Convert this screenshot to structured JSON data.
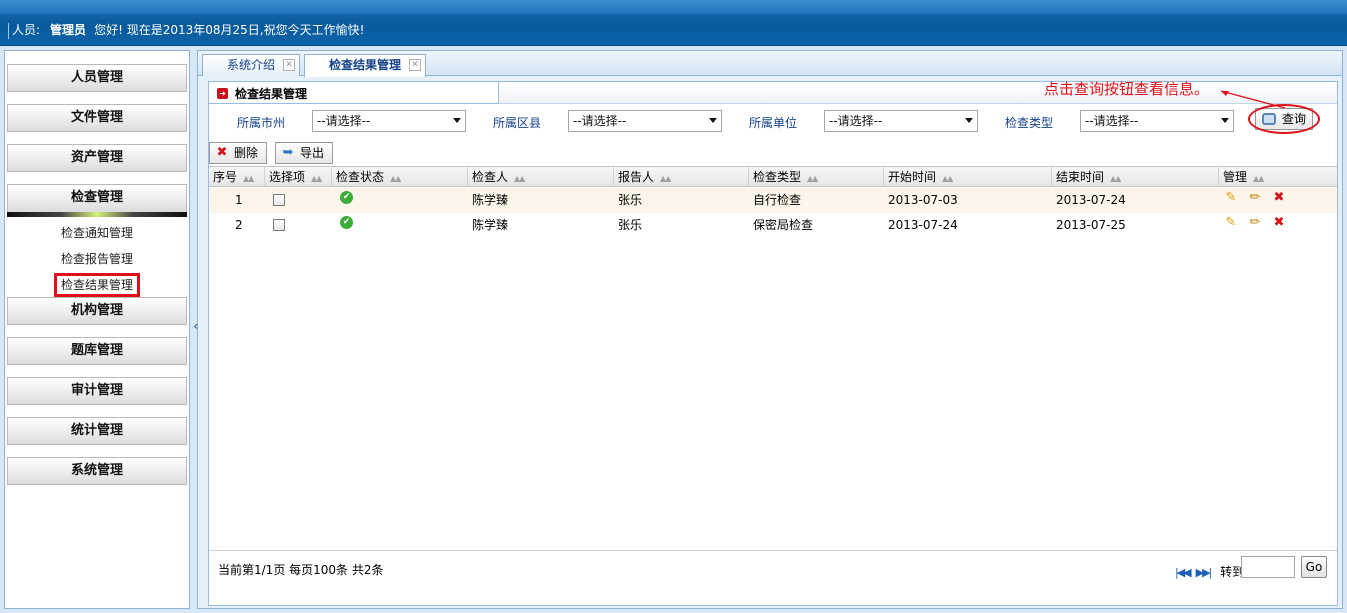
{
  "header": {
    "user_label": "人员:",
    "user_name": "管理员",
    "greeting": "您好!  现在是2013年08月25日,祝您今天工作愉快!"
  },
  "sidebar": {
    "menus": [
      {
        "label": "人员管理"
      },
      {
        "label": "文件管理"
      },
      {
        "label": "资产管理"
      },
      {
        "label": "检查管理"
      },
      {
        "label": "机构管理"
      },
      {
        "label": "题库管理"
      },
      {
        "label": "审计管理"
      },
      {
        "label": "统计管理"
      },
      {
        "label": "系统管理"
      }
    ],
    "submenu": [
      {
        "label": "检查通知管理"
      },
      {
        "label": "检查报告管理"
      },
      {
        "label": "检查结果管理"
      }
    ],
    "collapse_glyph": "«"
  },
  "tabs": [
    {
      "label": "系统介绍"
    },
    {
      "label": "检查结果管理"
    }
  ],
  "section_title": "检查结果管理",
  "annotation": "点击查询按钮查看信息。",
  "filters": [
    {
      "label": "所属市州",
      "value": "--请选择--"
    },
    {
      "label": "所属区县",
      "value": "--请选择--"
    },
    {
      "label": "所属单位",
      "value": "--请选择--"
    },
    {
      "label": "检查类型",
      "value": "--请选择--"
    }
  ],
  "query_label": "查询",
  "toolbar": {
    "delete_label": "删除",
    "export_label": "导出"
  },
  "table": {
    "columns": [
      "序号",
      "选择项",
      "检查状态",
      "检查人",
      "报告人",
      "检查类型",
      "开始时间",
      "结束时间",
      "管理"
    ],
    "rows": [
      {
        "index": "1",
        "inspector": "陈学臻",
        "reporter": "张乐",
        "type": "自行检查",
        "start": "2013-07-03",
        "end": "2013-07-24"
      },
      {
        "index": "2",
        "inspector": "陈学臻",
        "reporter": "张乐",
        "type": "保密局检查",
        "start": "2013-07-24",
        "end": "2013-07-25"
      }
    ]
  },
  "footer": {
    "page_info": "当前第1/1页  每页100条  共2条",
    "goto_label": "转到",
    "go_label": "Go"
  }
}
